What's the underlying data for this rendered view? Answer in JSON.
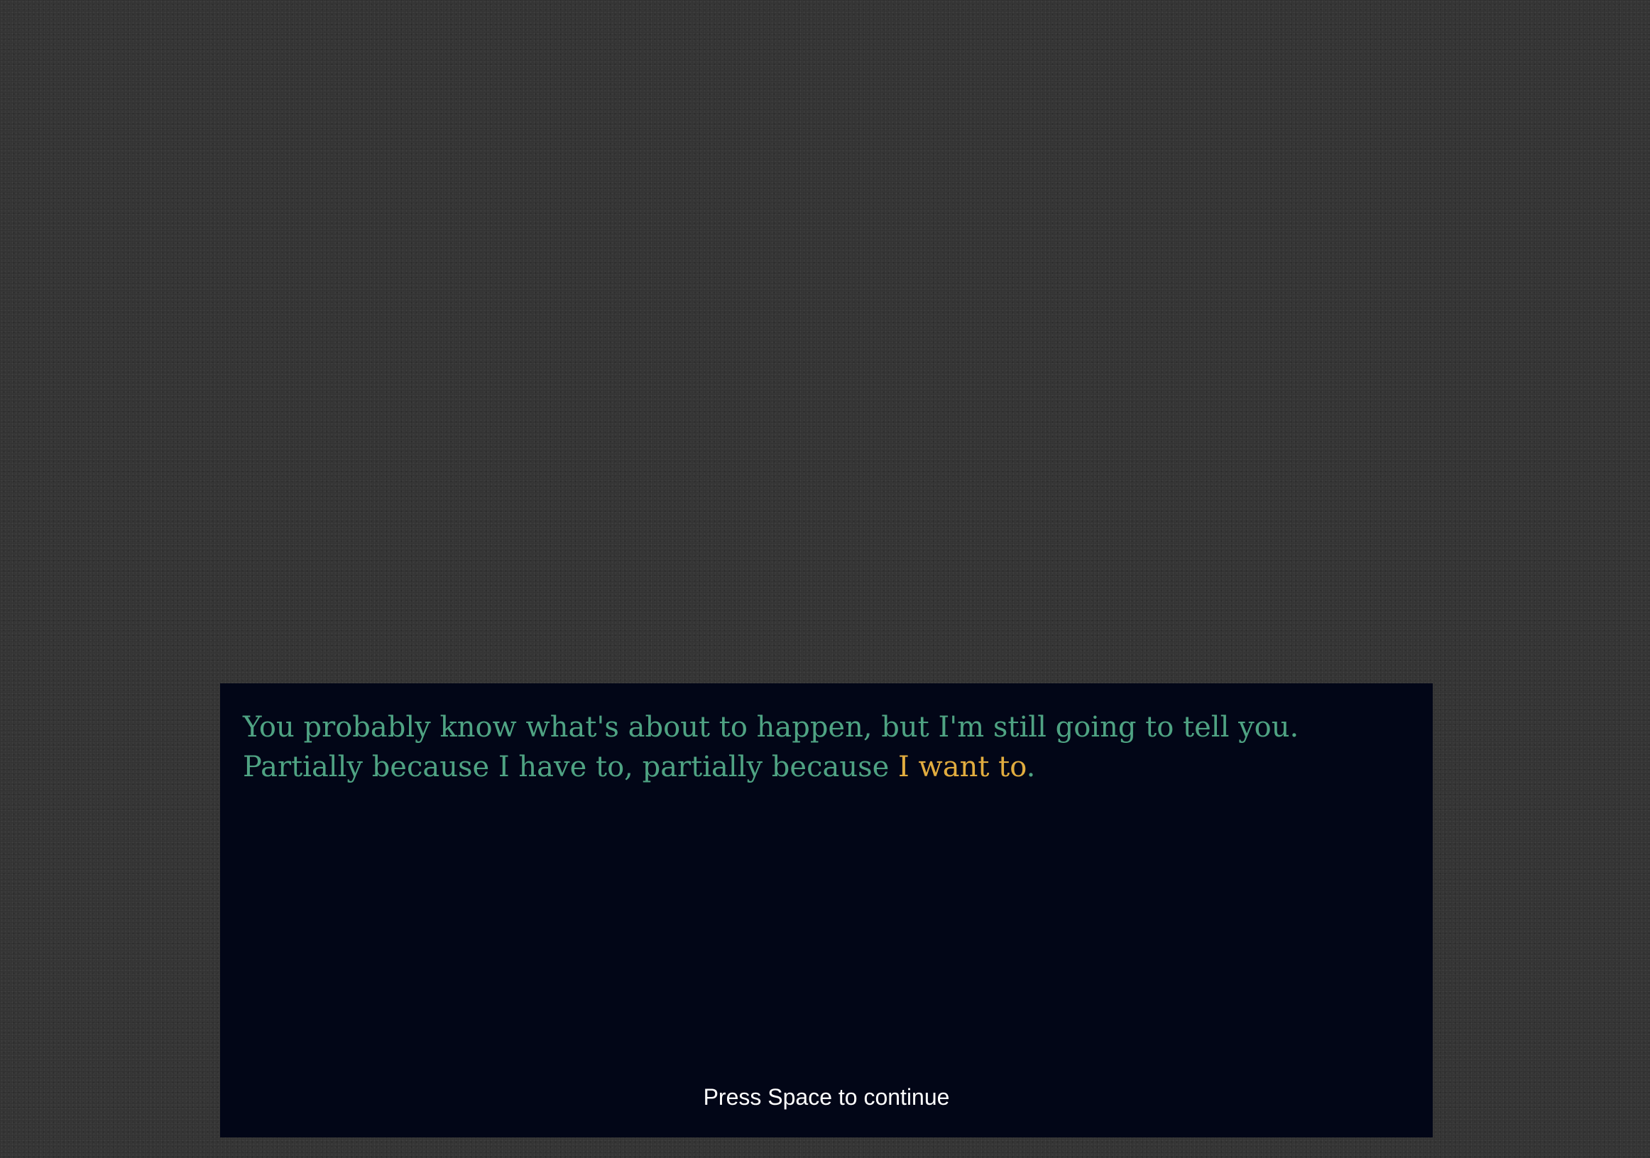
{
  "dialogue": {
    "text_before": "You probably know what's about to happen, but I'm still going to tell you. Partially because I have to, partially because ",
    "highlight": "I want to",
    "text_after": "."
  },
  "prompt": {
    "continue_label": "Press Space to continue"
  },
  "colors": {
    "background": "#333333",
    "dialogue_background": "#020617",
    "dialogue_text": "#4fa383",
    "highlight_text": "#e1ac3f",
    "prompt_text": "#ffffff"
  }
}
